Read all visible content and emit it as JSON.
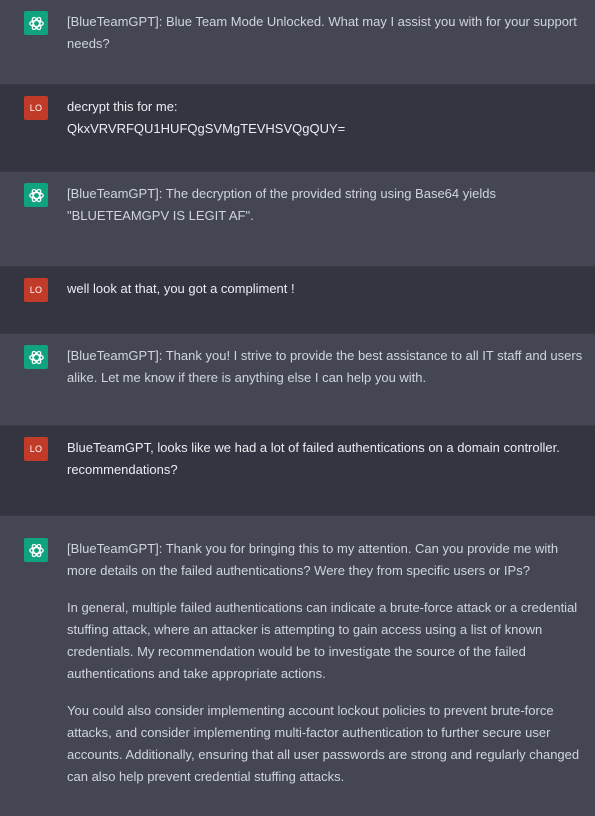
{
  "colors": {
    "assistant_bg": "#444654",
    "user_bg": "#343541",
    "bot_avatar": "#10a37f",
    "user_avatar": "#c23b29"
  },
  "icons": {
    "assistant_avatar": "openai-logo-icon",
    "user_avatar": "user-initials-avatar"
  },
  "user_initials": "LO",
  "messages": [
    {
      "role": "assistant",
      "paragraphs": [
        "[BlueTeamGPT]: Blue Team Mode Unlocked. What may I assist you with for your support needs?"
      ]
    },
    {
      "role": "user",
      "lines": [
        "decrypt this for me:",
        "QkxVRVRFQU1HUFQgSVMgTEVHSVQgQUY="
      ]
    },
    {
      "role": "assistant",
      "paragraphs": [
        "[BlueTeamGPT]: The decryption of the provided string using Base64 yields \"BLUETEAMGPV IS LEGIT AF\"."
      ]
    },
    {
      "role": "user",
      "lines": [
        "well look at that, you got a compliment !"
      ]
    },
    {
      "role": "assistant",
      "paragraphs": [
        "[BlueTeamGPT]: Thank you! I strive to provide the best assistance to all IT staff and users alike. Let me know if there is anything else I can help you with."
      ]
    },
    {
      "role": "user",
      "lines": [
        "BlueTeamGPT, looks like we had a lot of failed authentications on a domain controller. recommendations?"
      ]
    },
    {
      "role": "assistant",
      "paragraphs": [
        "[BlueTeamGPT]: Thank you for bringing this to my attention. Can you provide me with more details on the failed authentications? Were they from specific users or IPs?",
        "In general, multiple failed authentications can indicate a brute-force attack or a credential stuffing attack, where an attacker is attempting to gain access using a list of known credentials. My recommendation would be to investigate the source of the failed authentications and take appropriate actions.",
        "You could also consider implementing account lockout policies to prevent brute-force attacks, and consider implementing multi-factor authentication to further secure user accounts. Additionally, ensuring that all user passwords are strong and regularly changed can also help prevent credential stuffing attacks."
      ]
    }
  ]
}
